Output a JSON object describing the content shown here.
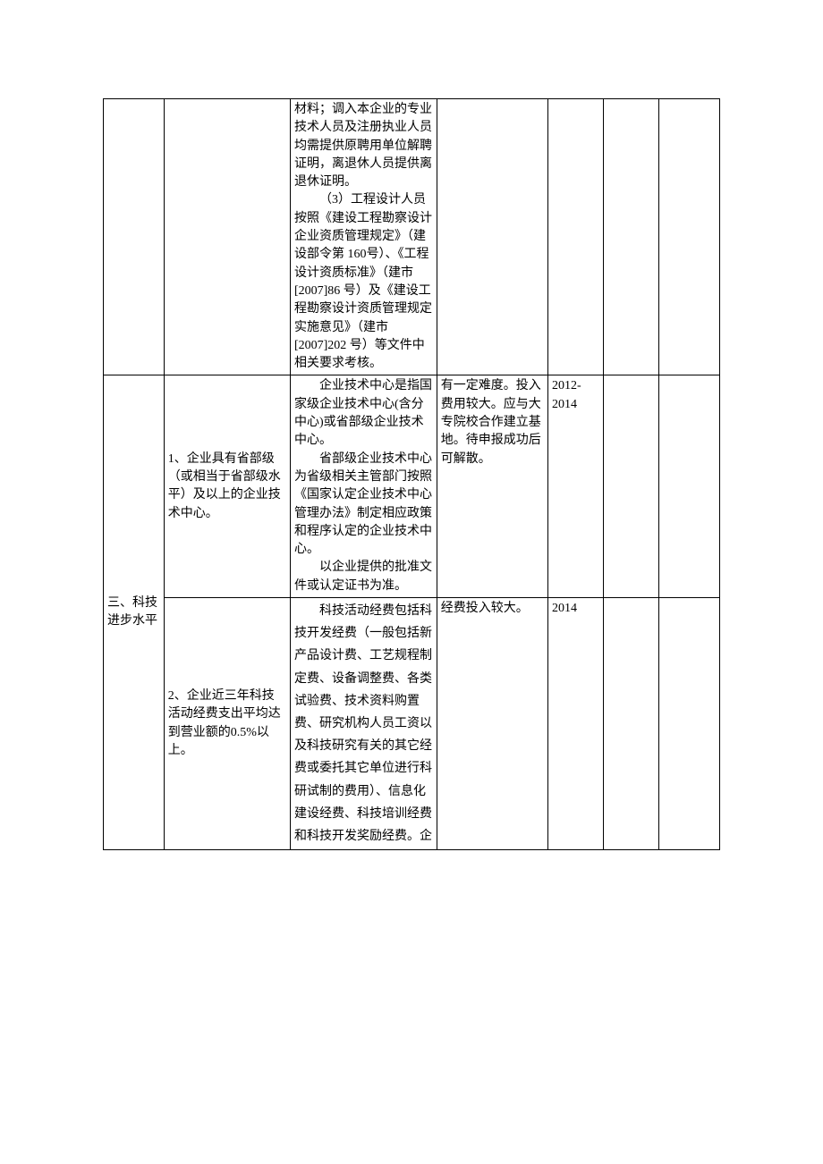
{
  "row1": {
    "col2_p1": "材料；调入本企业的专业技术人员及注册执业人员均需提供原聘用单位解聘证明，离退休人员提供离退休证明。",
    "col2_p2": "（3）工程设计人员按照《建设工程勘察设计企业资质管理规定》（建设部令第 160号）、《工程设计资质标准》（建市[2007]86 号）及《建设工程勘察设计资质管理规定实施意见》（建市[2007]202 号）等文件中相关要求考核。"
  },
  "section": {
    "title": "三、科技进步水平"
  },
  "row2": {
    "col1": "1、企业具有省部级（或相当于省部级水平）及以上的企业技术中心。",
    "col2_p1": "企业技术中心是指国家级企业技术中心(含分中心)或省部级企业技术中心。",
    "col2_p2": "省部级企业技术中心为省级相关主管部门按照《国家认定企业技术中心管理办法》制定相应政策和程序认定的企业技术中心。",
    "col2_p3": "以企业提供的批准文件或认定证书为准。",
    "col3": "有一定难度。投入费用较大。应与大专院校合作建立基地。待申报成功后可解散。",
    "col4": "2012-2014"
  },
  "row3": {
    "col1": "2、企业近三年科技活动经费支出平均达到营业额的0.5%以上。",
    "col2_p1": "科技活动经费包括科技开发经费（一般包括新产品设计费、工艺规程制定费、设备调整费、各类试验费、技术资料购置费、研究机构人员工资以及科技研究有关的其它经费或委托其它单位进行科研试制的费用）、信息化建设经费、科技培训经费和科技开发奖励经费。企",
    "col3": "经费投入较大。",
    "col4": "2014"
  }
}
